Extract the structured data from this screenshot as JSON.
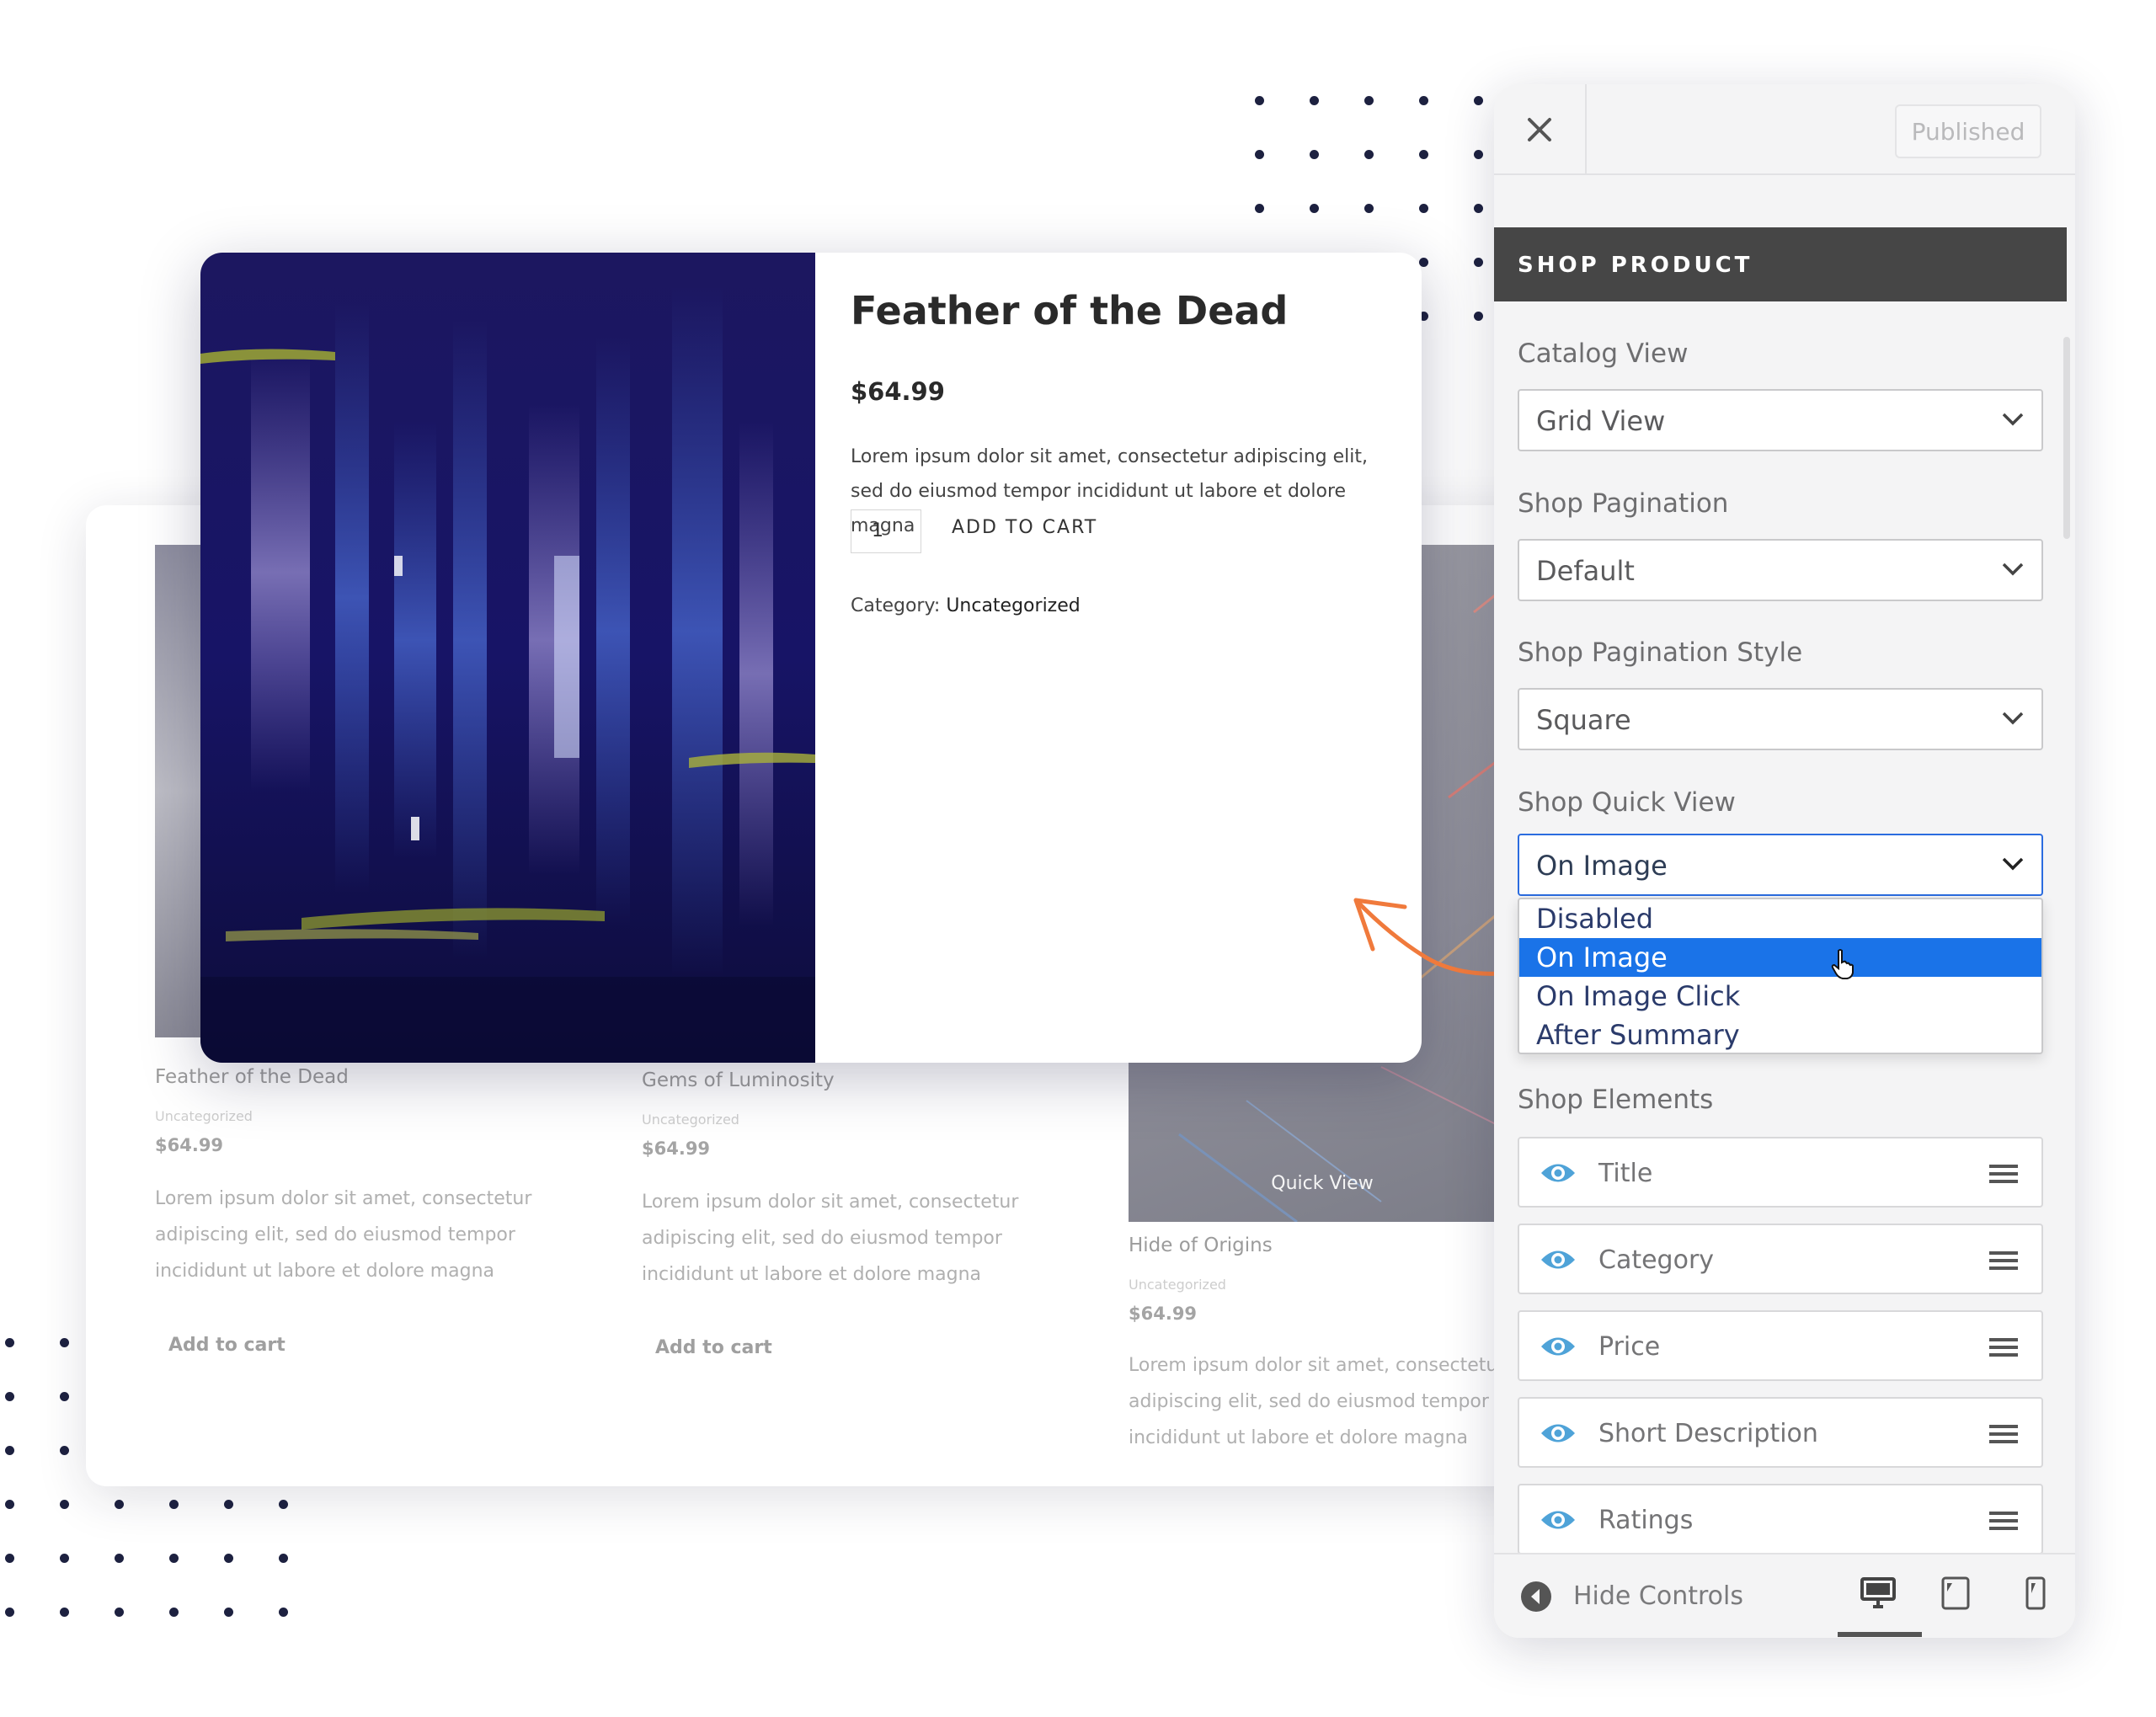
{
  "products": [
    {
      "title": "Feather of the Dead",
      "category": "Uncategorized",
      "price": "$64.99",
      "description": "Lorem ipsum dolor sit amet, consectetur adipiscing elit, sed do eiusmod tempor incididunt ut labore et dolore magna",
      "cart": "Add to cart"
    },
    {
      "title": "Gems of Luminosity",
      "category": "Uncategorized",
      "price": "$64.99",
      "description": "Lorem ipsum dolor sit amet, consectetur adipiscing elit, sed do eiusmod tempor incididunt ut labore et dolore magna",
      "cart": "Add to cart"
    },
    {
      "title": "Hide of Origins",
      "category": "Uncategorized",
      "price": "$64.99",
      "description": "Lorem ipsum dolor sit amet, consectetur adipiscing elit, sed do eiusmod tempor incididunt ut labore et dolore magna",
      "quick_view": "Quick View"
    }
  ],
  "modal": {
    "title": "Feather of the Dead",
    "price": "$64.99",
    "description": "Lorem ipsum dolor sit amet, consectetur adipiscing elit, sed do eiusmod tempor incididunt ut labore et dolore magna",
    "quantity": "1",
    "add_to_cart": "ADD TO CART",
    "category_label": "Category:",
    "category_value": "Uncategorized"
  },
  "panel": {
    "published": "Published",
    "section_title": "SHOP PRODUCT",
    "catalog_view": {
      "label": "Catalog View",
      "value": "Grid View"
    },
    "shop_pagination": {
      "label": "Shop Pagination",
      "value": "Default"
    },
    "pagination_style": {
      "label": "Shop Pagination Style",
      "value": "Square"
    },
    "quick_view": {
      "label": "Shop Quick View",
      "value": "On Image",
      "options": [
        "Disabled",
        "On Image",
        "On Image Click",
        "After Summary"
      ],
      "selected_index": 1
    },
    "shop_elements": {
      "label": "Shop Elements",
      "items": [
        "Title",
        "Category",
        "Price",
        "Short Description",
        "Ratings"
      ]
    },
    "hide_controls": "Hide Controls",
    "active_device": "desktop"
  },
  "colors": {
    "accent_blue": "#1a73e8",
    "eye_icon": "#4fa3d8",
    "arrow_orange": "#f07a3c",
    "section_head": "#464646"
  }
}
